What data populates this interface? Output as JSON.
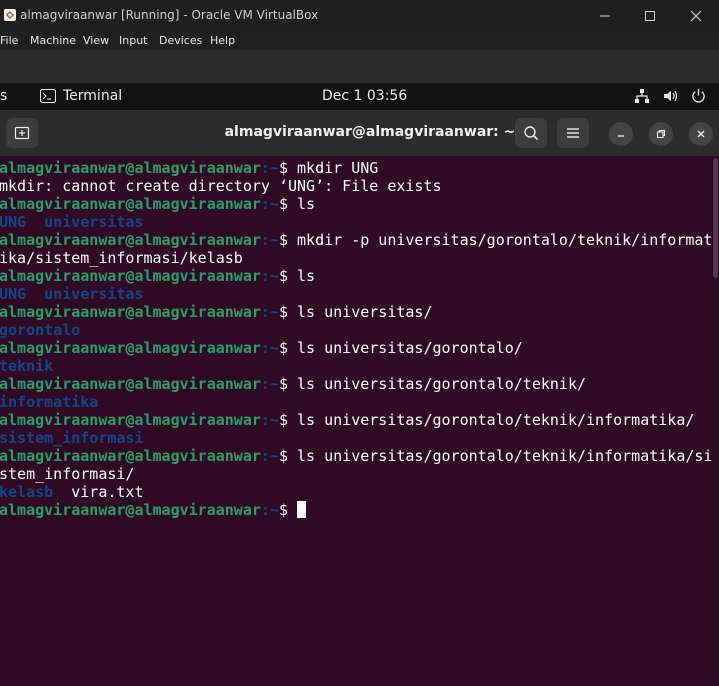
{
  "window": {
    "title": "almagviraanwar [Running] - Oracle VM VirtualBox",
    "menu": [
      "File",
      "Machine",
      "View",
      "Input",
      "Devices",
      "Help"
    ]
  },
  "topbar": {
    "activities_fragment": "s",
    "app_name": "Terminal",
    "clock": "Dec 1  03:56"
  },
  "header": {
    "title": "almagviraanwar@almagviraanwar: ~"
  },
  "prompt": {
    "user_host": "almagviraanwar@almagviraanwar",
    "path_suffix": ":~",
    "symbol": "$ "
  },
  "terminal": {
    "lines": [
      {
        "type": "prompt",
        "cmd": "mkdir UNG"
      },
      {
        "type": "output",
        "text": "mkdir: cannot create directory ‘UNG’: File exists"
      },
      {
        "type": "prompt",
        "cmd": "ls"
      },
      {
        "type": "dirs",
        "text": "UNG  universitas"
      },
      {
        "type": "prompt",
        "cmd": "mkdir -p universitas/gorontalo/teknik/informat"
      },
      {
        "type": "output",
        "text": "ika/sistem_informasi/kelasb"
      },
      {
        "type": "prompt",
        "cmd": "ls"
      },
      {
        "type": "dirs",
        "text": "UNG  universitas"
      },
      {
        "type": "prompt",
        "cmd": "ls universitas/"
      },
      {
        "type": "dirs",
        "text": "gorontalo"
      },
      {
        "type": "prompt",
        "cmd": "ls universitas/gorontalo/"
      },
      {
        "type": "dirs",
        "text": "teknik"
      },
      {
        "type": "prompt",
        "cmd": "ls universitas/gorontalo/teknik/"
      },
      {
        "type": "dirs",
        "text": "informatika"
      },
      {
        "type": "prompt",
        "cmd": "ls universitas/gorontalo/teknik/informatika/"
      },
      {
        "type": "dirs",
        "text": "sistem_informasi"
      },
      {
        "type": "prompt",
        "cmd": "ls universitas/gorontalo/teknik/informatika/si"
      },
      {
        "type": "output",
        "text": "stem_informasi/"
      },
      {
        "type": "mixed",
        "dir": "kelasb",
        "rest": "  vira.txt"
      },
      {
        "type": "cursor",
        "cmd": ""
      }
    ]
  },
  "colors": {
    "terminal_bg": "#300a24",
    "prompt_user": "#26a269",
    "prompt_path": "#12488b",
    "directory": "#12488b"
  }
}
